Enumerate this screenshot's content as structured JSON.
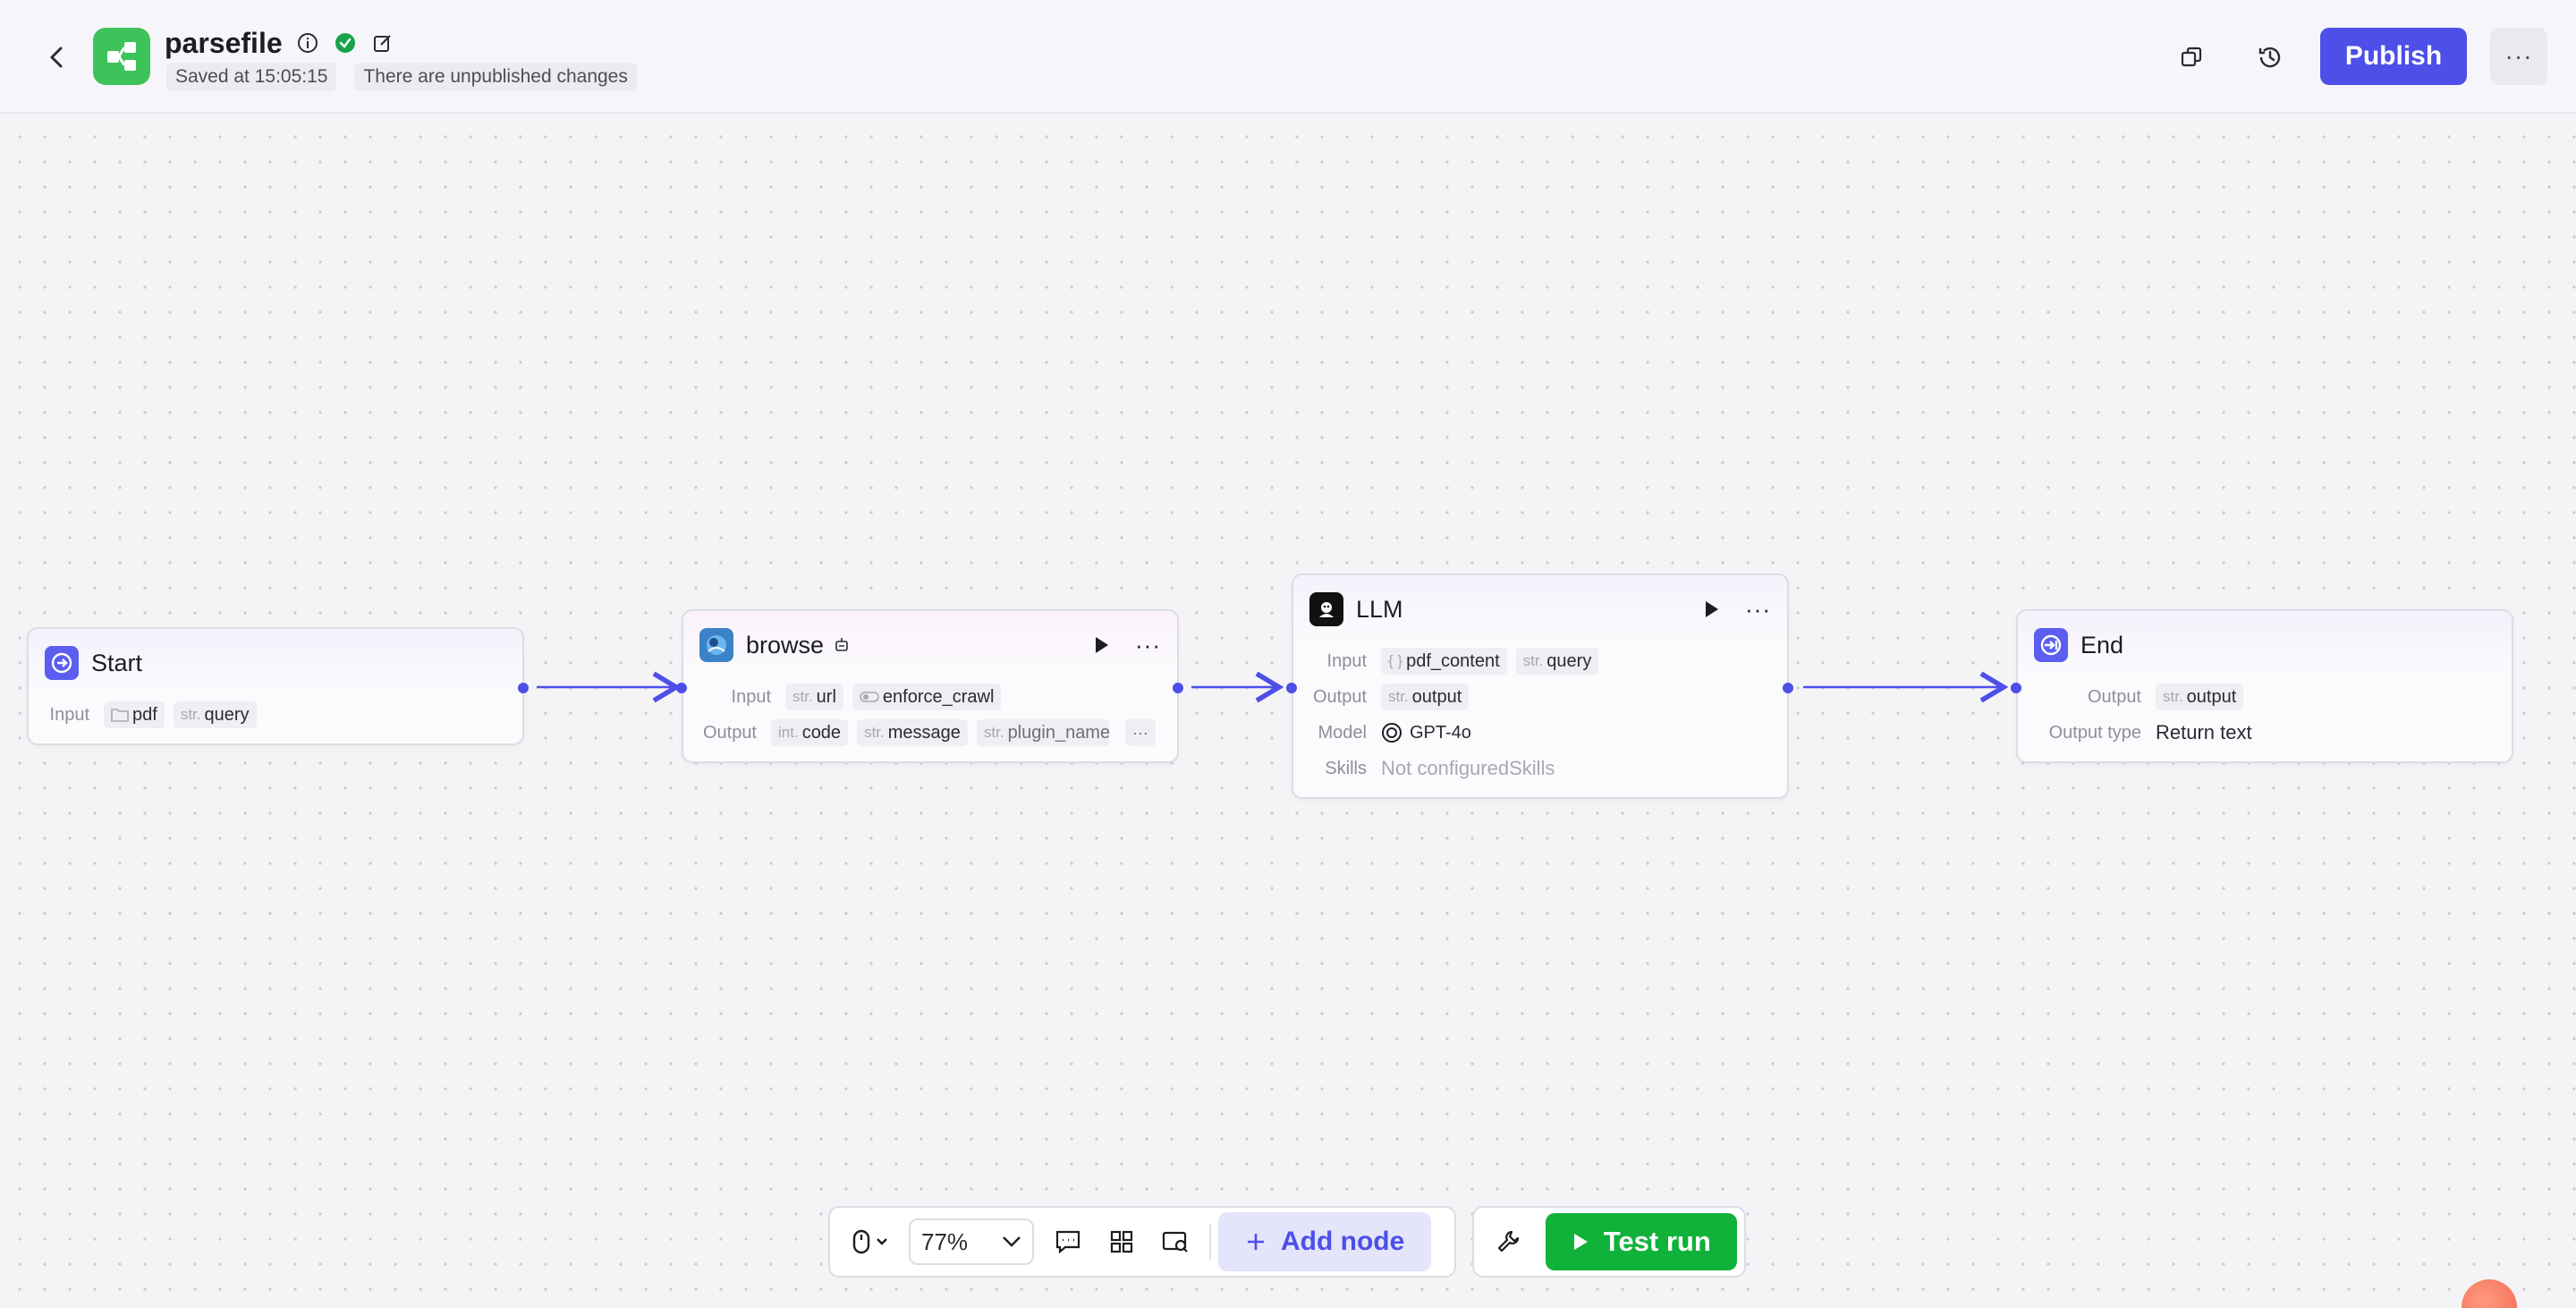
{
  "header": {
    "title": "parsefile",
    "saved_text": "Saved at 15:05:15",
    "changes_text": "There are unpublished changes",
    "publish_label": "Publish",
    "more_label": "···"
  },
  "nodes": {
    "start": {
      "title": "Start",
      "input_label": "Input",
      "inputs": [
        {
          "type": "",
          "name": "pdf"
        },
        {
          "type": "str.",
          "name": "query"
        }
      ]
    },
    "browse": {
      "title": "browse",
      "input_label": "Input",
      "output_label": "Output",
      "inputs": [
        {
          "type": "str.",
          "name": "url"
        },
        {
          "type": "",
          "name": "enforce_crawl"
        }
      ],
      "outputs": [
        {
          "type": "int.",
          "name": "code"
        },
        {
          "type": "str.",
          "name": "message"
        },
        {
          "type": "str.",
          "name": "plugin_name"
        }
      ],
      "overflow": "···"
    },
    "llm": {
      "title": "LLM",
      "input_label": "Input",
      "output_label": "Output",
      "model_label": "Model",
      "skills_label": "Skills",
      "inputs": [
        {
          "type": "{ }",
          "name": "pdf_content"
        },
        {
          "type": "str.",
          "name": "query"
        }
      ],
      "outputs": [
        {
          "type": "str.",
          "name": "output"
        }
      ],
      "model": "GPT-4o",
      "skills": "Not configuredSkills"
    },
    "end": {
      "title": "End",
      "output_label": "Output",
      "output_type_label": "Output type",
      "outputs": [
        {
          "type": "str.",
          "name": "output"
        }
      ],
      "output_type": "Return text"
    }
  },
  "toolbar": {
    "zoom": "77%",
    "add_node_label": "Add node",
    "test_run_label": "Test run"
  },
  "colors": {
    "accent": "#4d4fe8",
    "app_icon": "#3ec25a",
    "test_run": "#10b23a",
    "status_ok": "#16a34a"
  },
  "icons": [
    "back-icon",
    "workflow-icon",
    "info-icon",
    "check-circle-icon",
    "edit-icon",
    "copy-icon",
    "history-icon",
    "more-icon",
    "play-icon",
    "mouse-icon",
    "comment-icon",
    "grid-icon",
    "minimap-icon",
    "plus-icon",
    "wrench-icon"
  ]
}
